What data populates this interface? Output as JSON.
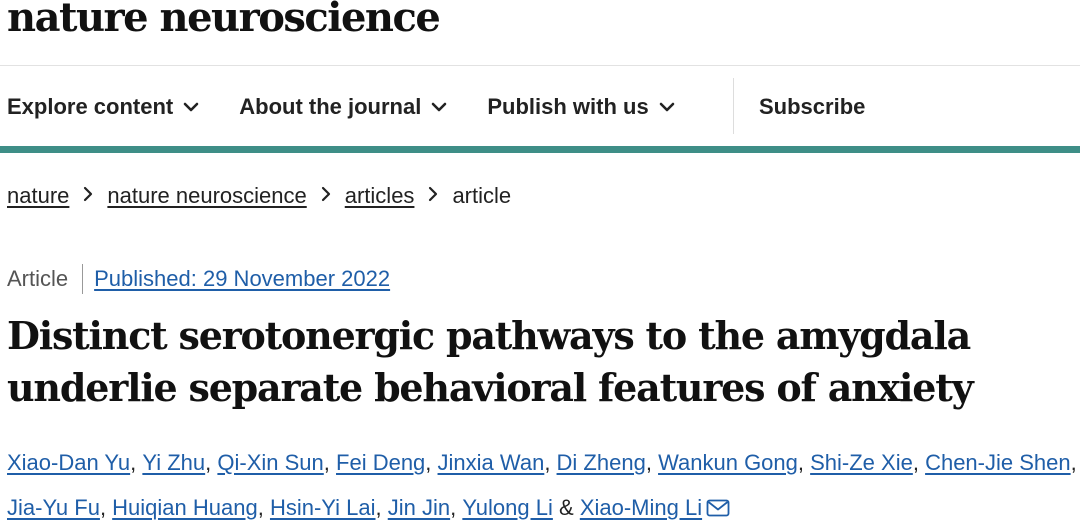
{
  "site": {
    "logo": "nature neuroscience"
  },
  "nav": {
    "items": [
      {
        "label": "Explore content",
        "icon": "chevron-down-icon"
      },
      {
        "label": "About the journal",
        "icon": "chevron-down-icon"
      },
      {
        "label": "Publish with us",
        "icon": "chevron-down-icon"
      }
    ],
    "subscribe": "Subscribe"
  },
  "breadcrumb": {
    "items": [
      "nature",
      "nature neuroscience",
      "articles"
    ],
    "current": "article"
  },
  "article": {
    "type": "Article",
    "published": "Published: 29 November 2022",
    "title": "Distinct serotonergic pathways to the amygdala underlie separate behavioral features of anxiety",
    "authors": [
      "Xiao-Dan Yu",
      "Yi Zhu",
      "Qi-Xin Sun",
      "Fei Deng",
      "Jinxia Wan",
      "Di Zheng",
      "Wankun Gong",
      "Shi-Ze Xie",
      "Chen-Jie Shen",
      "Jia-Yu Fu",
      "Huiqian Huang",
      "Hsin-Yi Lai",
      "Jin Jin",
      "Yulong Li"
    ],
    "last_author_joiner": "&",
    "last_author": "Xiao-Ming Li",
    "contact_icon": "mail-icon"
  },
  "colors": {
    "accent_band": "#3e8e87",
    "link": "#1f5ea8"
  }
}
